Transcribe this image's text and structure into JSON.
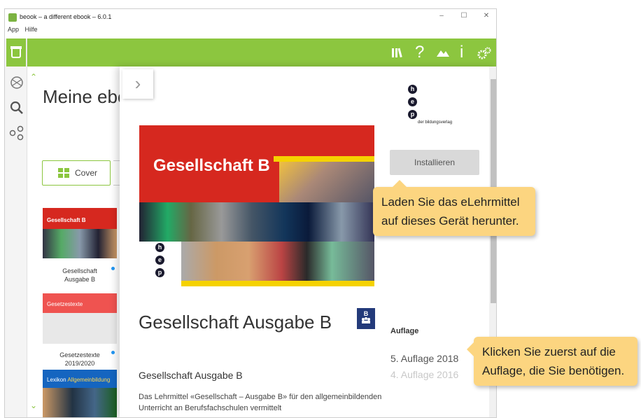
{
  "window": {
    "title": "beook – a different ebook – 6.0.1",
    "menu": [
      "App",
      "Hilfe"
    ],
    "controls": [
      "–",
      "☐",
      "✕"
    ]
  },
  "toolbar_icons": [
    "library-icon",
    "help-icon",
    "landscape-icon",
    "info-icon",
    "settings-icon"
  ],
  "sidebar_icons": [
    "home-icon",
    "globe-icon",
    "search-icon",
    "share-icon"
  ],
  "library": {
    "heading": "Meine ebo",
    "view_button": "Cover",
    "books": [
      {
        "cover_title": "Gesellschaft B",
        "title_line1": "Gesellschaft",
        "title_line2": "Ausgabe B",
        "color": "#d6281f"
      },
      {
        "cover_title": "Gesetzestexte",
        "title_line1": "Gesetzestexte",
        "title_line2": "2019/2020",
        "color": "#ef5350"
      },
      {
        "cover_title": "Lexikon",
        "cover_title_extra": "Allgemeinbildung",
        "title_line1": "",
        "title_line2": "",
        "color": "#1565c0"
      }
    ]
  },
  "detail": {
    "close_glyph": "›",
    "publisher_letters": [
      "h",
      "e",
      "p"
    ],
    "publisher_name": "der bildungsverlag",
    "install_button": "Installieren",
    "cover_title": "Gesellschaft B",
    "title": "Gesellschaft Ausgabe B",
    "badge": "B",
    "subtitle": "Gesellschaft Ausgabe B",
    "description": "Das Lehrmittel «Gesellschaft – Ausgabe B» für den allgemeinbildenden Unterricht an Berufsfachschulen vermittelt",
    "auflage_label": "Auflage",
    "auflagen": [
      {
        "label": "5. Auflage 2018",
        "color": "#555555"
      },
      {
        "label": "4. Auflage 2016",
        "color": "#c8c8c8"
      }
    ]
  },
  "tooltips": {
    "install": {
      "line1": "Laden Sie das eLehrmittel",
      "line2": "auf dieses Gerät herunter."
    },
    "auflage": {
      "line1": "Klicken Sie zuerst auf die",
      "line2": "Auflage, die Sie benötigen."
    }
  },
  "colors": {
    "accent": "#8cc63f",
    "tooltip": "#fcd580",
    "cover_red": "#d6281f"
  }
}
